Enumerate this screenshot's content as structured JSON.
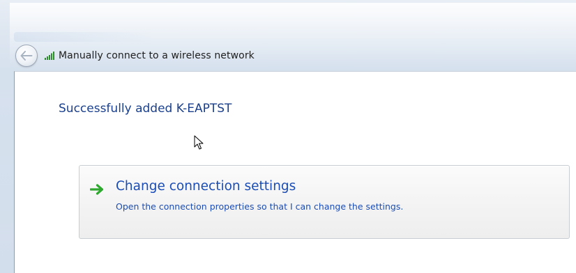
{
  "window": {
    "title": "Manually connect to a wireless network"
  },
  "icons": {
    "back": "back-arrow-icon",
    "signal": "wireless-signal-icon",
    "link_arrow": "green-arrow-icon",
    "cursor": "mouse-pointer-icon"
  },
  "main": {
    "heading": "Successfully added K-EAPTST",
    "command_link": {
      "title": "Change connection settings",
      "description": "Open the connection properties so that I can change the settings."
    }
  },
  "colors": {
    "heading": "#1a3f8c",
    "link": "#1b4db5",
    "arrow": "#2fa82f"
  }
}
